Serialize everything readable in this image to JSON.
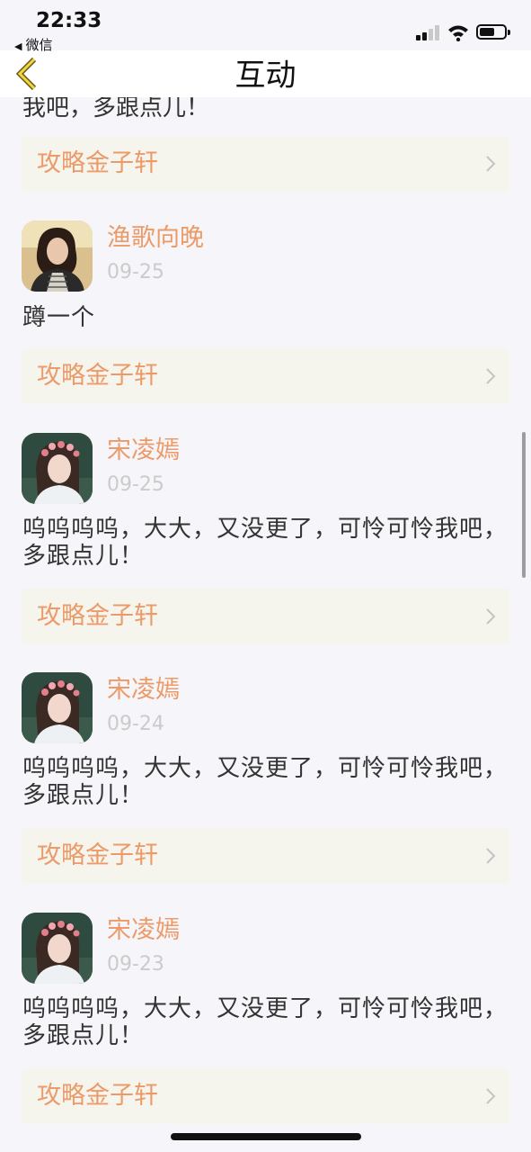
{
  "status_bar": {
    "time": "22:33",
    "back_app": "微信",
    "tri": "◀"
  },
  "nav": {
    "title": "互动"
  },
  "partial_top_text": "我吧，多跟点儿！",
  "colors": {
    "accent": "#ec9a68",
    "date": "#cbcbcb",
    "text": "#333333",
    "link_bg": "#f5f5ee"
  },
  "top_book_link": {
    "book": "攻略金子轩"
  },
  "comments": [
    {
      "user": "渔歌向晚",
      "date": "09-25",
      "text": "蹲一个",
      "book": "攻略金子轩",
      "avatar": "avatar-woman-plaid"
    },
    {
      "user": "宋凌嫣",
      "date": "09-25",
      "text": "呜呜呜呜，大大，又没更了，可怜可怜我吧，多跟点儿！",
      "book": "攻略金子轩",
      "avatar": "avatar-woman-flowers"
    },
    {
      "user": "宋凌嫣",
      "date": "09-24",
      "text": "呜呜呜呜，大大，又没更了，可怜可怜我吧，多跟点儿！",
      "book": "攻略金子轩",
      "avatar": "avatar-woman-flowers"
    },
    {
      "user": "宋凌嫣",
      "date": "09-23",
      "text": "呜呜呜呜，大大，又没更了，可怜可怜我吧，多跟点儿！",
      "book": "攻略金子轩",
      "avatar": "avatar-woman-flowers"
    }
  ]
}
